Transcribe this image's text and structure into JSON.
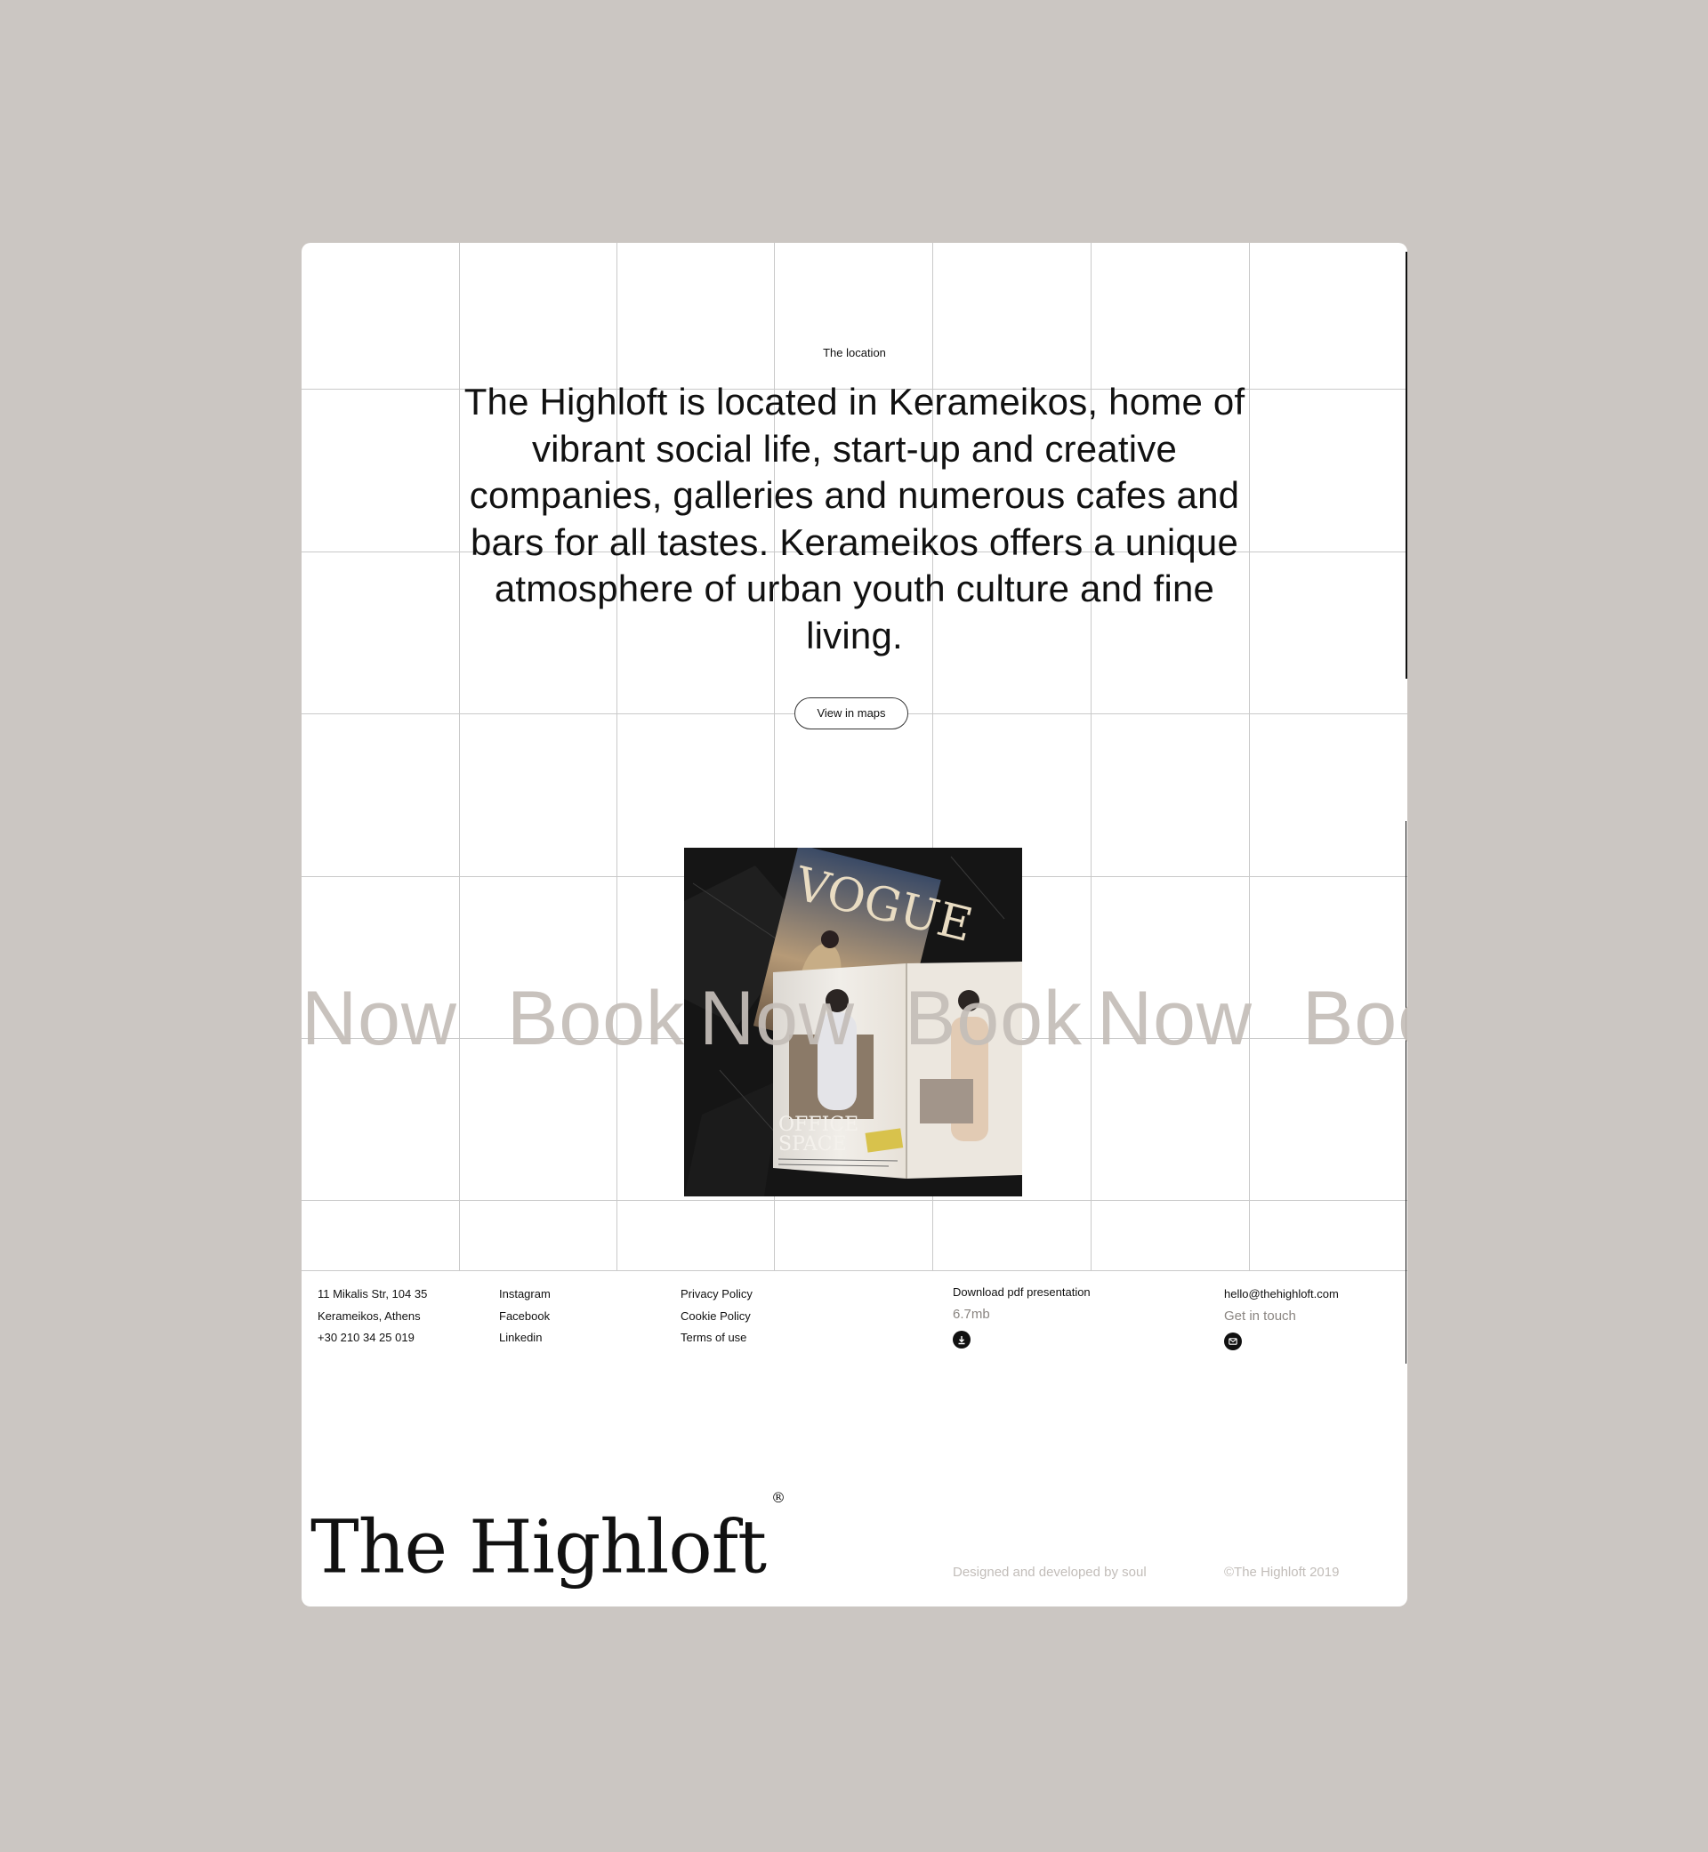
{
  "location": {
    "eyebrow": "The location",
    "headline": "The Highloft is located in Kerameikos, home of vibrant social life, start-up and creative companies, galleries and numerous cafes and bars for all tastes. Kerameikos offers a unique atmosphere of urban youth culture and fine living.",
    "maps_button": "View in maps"
  },
  "marquee": {
    "words": [
      "Now",
      "Book",
      "Now",
      "Book",
      "Now",
      "Book"
    ]
  },
  "photo": {
    "magazine_title": "VOGUE",
    "spread_heading_line1": "OFFICE",
    "spread_heading_line2": "SPACE"
  },
  "footer": {
    "address": [
      "11 Mikalis Str, 104 35",
      "Kerameikos, Athens",
      "+30 210 34 25 019"
    ],
    "social": [
      "Instagram",
      "Facebook",
      "Linkedin"
    ],
    "legal": [
      "Privacy Policy",
      "Cookie Policy",
      "Terms of use"
    ],
    "download": {
      "label": "Download pdf presentation",
      "size": "6.7mb",
      "icon": "download-icon"
    },
    "contact": {
      "email": "hello@thehighloft.com",
      "cta": "Get in touch",
      "icon": "mail-icon"
    }
  },
  "brand": {
    "logo": "The Highloft",
    "registered_mark": "®",
    "credit": "Designed and developed by soul",
    "copyright": "©The Highloft 2019"
  },
  "colors": {
    "background": "#cbc6c2",
    "card": "#ffffff",
    "grid_line": "#c9c9c9",
    "marquee_text": "#c4bdb8",
    "text": "#111111",
    "muted_text": "#8a8581"
  }
}
